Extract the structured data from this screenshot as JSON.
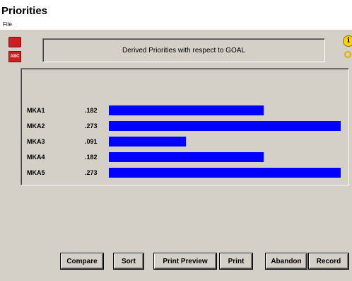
{
  "window": {
    "title": "Priorities"
  },
  "menu": {
    "file": "File"
  },
  "header": {
    "text": "Derived Priorities with respect to GOAL",
    "abc_icon_text": "ABC"
  },
  "rows": [
    {
      "label": "MKA1",
      "value": ".182",
      "weight": 0.182
    },
    {
      "label": "MKA2",
      "value": ".273",
      "weight": 0.273
    },
    {
      "label": "MKA3",
      "value": ".091",
      "weight": 0.091
    },
    {
      "label": "MKA4",
      "value": ".182",
      "weight": 0.182
    },
    {
      "label": "MKA5",
      "value": ".273",
      "weight": 0.273
    }
  ],
  "buttons": {
    "compare": "Compare",
    "sort": "Sort",
    "print_preview": "Print Preview",
    "print": "Print",
    "abandon": "Abandon",
    "record": "Record"
  },
  "colors": {
    "bar": "#0000ff",
    "background": "#d4d0c8"
  }
}
